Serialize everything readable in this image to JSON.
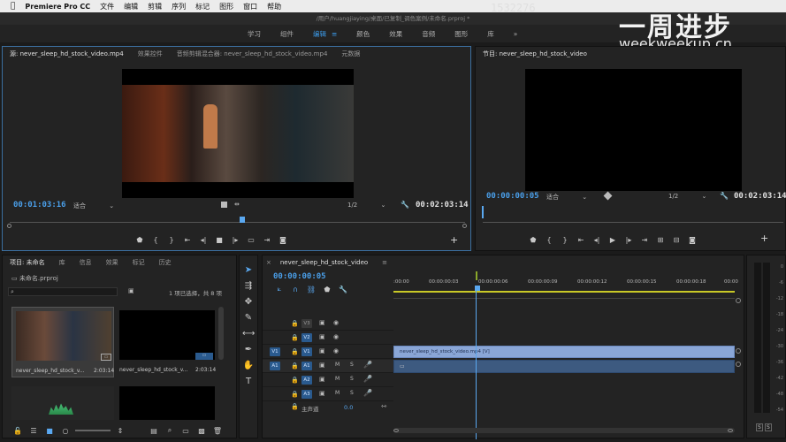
{
  "menubar": {
    "apple": "",
    "app": "Premiere Pro CC",
    "items": [
      "文件",
      "编辑",
      "剪辑",
      "序列",
      "标记",
      "图形",
      "窗口",
      "帮助"
    ]
  },
  "title": "/用户/huangjiaying/桌面/已复制_调色案例/未命名.prproj *",
  "workspaces": [
    "学习",
    "组件",
    "编辑",
    "颜色",
    "效果",
    "音频",
    "图形",
    "库"
  ],
  "workspace_active": "编辑",
  "workspace_more": "»",
  "watermark": {
    "big": "一周进步",
    "url": "weekweekup.cn",
    "overlay": "1532276"
  },
  "source": {
    "tabs": [
      "源: never_sleep_hd_stock_video.mp4",
      "效果控件",
      "音频剪辑混合器: never_sleep_hd_stock_video.mp4",
      "元数据"
    ],
    "timecode_left": "00:01:03:16",
    "fit": "适合",
    "ratio": "1/2",
    "timecode_right": "00:02:03:14"
  },
  "program": {
    "tab": "节目: never_sleep_hd_stock_video",
    "timecode_left": "00:00:00:05",
    "fit": "适合",
    "ratio": "1/2",
    "timecode_right": "00:02:03:14"
  },
  "project": {
    "tabs": [
      "项目: 未命名",
      "库",
      "信息",
      "效果",
      "标记",
      "历史"
    ],
    "file": "未命名.prproj",
    "search_placeholder": "",
    "selection": "1 项已选择，共 8 项",
    "items": [
      {
        "name": "never_sleep_hd_stock_v...",
        "duration": "2:03:14"
      },
      {
        "name": "never_sleep_hd_stock_v...",
        "duration": "2:03:14"
      }
    ]
  },
  "timeline": {
    "tab": "never_sleep_hd_stock_video",
    "timecode": "00:00:00:05",
    "ruler": [
      ":00:00",
      "00:00:00:03",
      "00:00:00:06",
      "00:00:00:09",
      "00:00:00:12",
      "00:00:00:15",
      "00:00:00:18",
      "00:00"
    ],
    "video_tracks": [
      "V3",
      "V2",
      "V1"
    ],
    "audio_tracks": [
      "A1",
      "A2",
      "A3"
    ],
    "source_v": "V1",
    "source_a": "A1",
    "master_label": "主声道",
    "master_value": "0.0",
    "clip_label": "never_sleep_hd_stock_video.mp4 [V]"
  },
  "meter": {
    "labels": [
      "0",
      "-6",
      "-12",
      "-18",
      "-24",
      "-30",
      "-36",
      "-42",
      "-48",
      "-54"
    ],
    "solo": [
      "S",
      "S"
    ]
  },
  "colors": {
    "accent": "#3b9ae8",
    "clip_video": "#8aa6d6",
    "clip_audio": "#3d5a80"
  }
}
